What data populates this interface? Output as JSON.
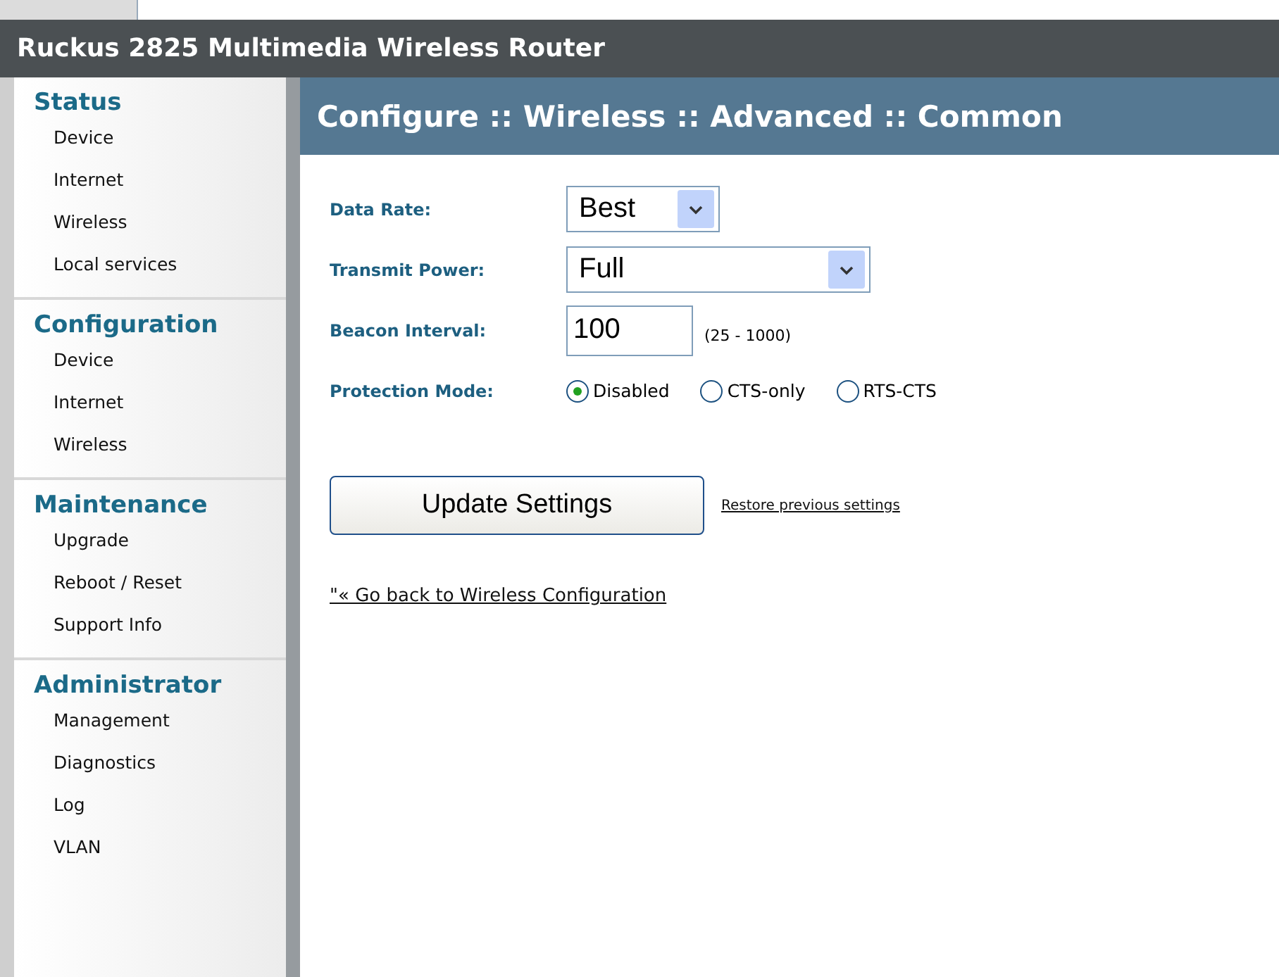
{
  "header": {
    "title": "Ruckus 2825 Multimedia Wireless Router"
  },
  "sidebar": {
    "sections": [
      {
        "heading": "Status",
        "items": [
          "Device",
          "Internet",
          "Wireless",
          "Local services"
        ]
      },
      {
        "heading": "Configuration",
        "items": [
          "Device",
          "Internet",
          "Wireless"
        ]
      },
      {
        "heading": "Maintenance",
        "items": [
          "Upgrade",
          "Reboot / Reset",
          "Support Info"
        ]
      },
      {
        "heading": "Administrator",
        "items": [
          "Management",
          "Diagnostics",
          "Log",
          "VLAN"
        ]
      }
    ]
  },
  "page_title": "Configure :: Wireless :: Advanced :: Common",
  "form": {
    "fields": [
      {
        "kind": "select",
        "label": "Data Rate:",
        "value": "Best"
      },
      {
        "kind": "select",
        "label": "Transmit Power:",
        "value": "Full"
      },
      {
        "kind": "text",
        "label": "Beacon Interval:",
        "value": "100",
        "hint": "(25 - 1000)"
      },
      {
        "kind": "radio",
        "label": "Protection Mode:",
        "options": [
          {
            "label": "Disabled",
            "selected": true
          },
          {
            "label": "CTS-only",
            "selected": false
          },
          {
            "label": "RTS-CTS",
            "selected": false
          }
        ]
      }
    ]
  },
  "buttons": {
    "update": "Update Settings",
    "restore": "Restore previous settings"
  },
  "back_link": "\"« Go back to Wireless Configuration"
}
